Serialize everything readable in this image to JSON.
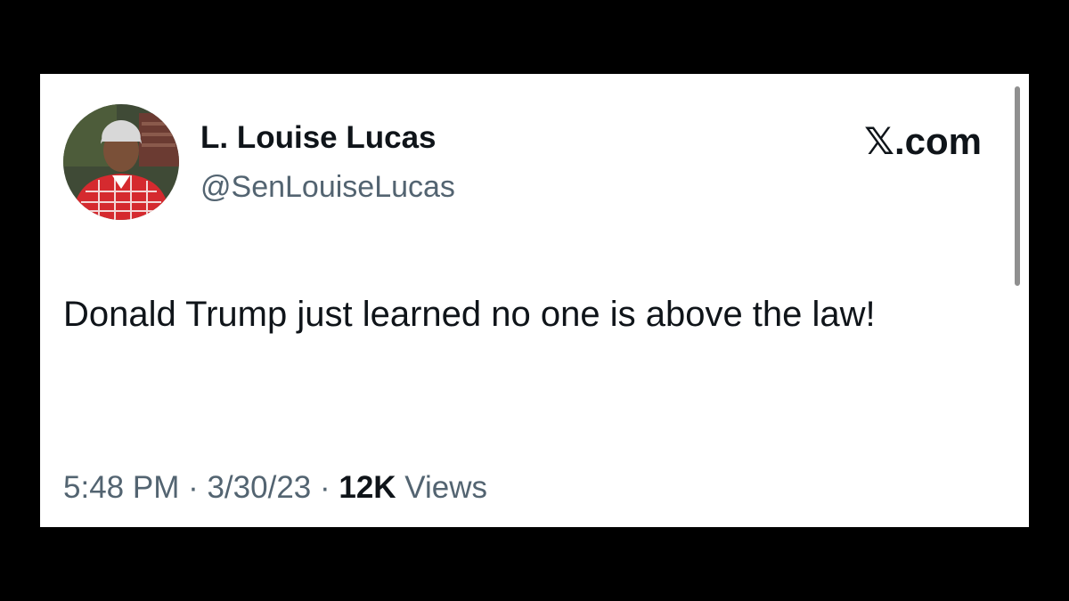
{
  "tweet": {
    "author": {
      "display_name": "L. Louise Lucas",
      "handle": "@SenLouiseLucas",
      "avatar_icon": "profile-photo"
    },
    "brand": {
      "x_glyph": "𝕏",
      "domain_suffix": ".com"
    },
    "text": "Donald Trump just learned no one is above the law!",
    "meta": {
      "time": "5:48 PM",
      "separator_1": " · ",
      "date": "3/30/23",
      "separator_2": " · ",
      "views_count": "12K",
      "views_label": " Views"
    }
  },
  "colors": {
    "background": "#000000",
    "card": "#ffffff",
    "primary_text": "#0f1419",
    "secondary_text": "#536471",
    "scrollbar": "#8f8f8f"
  }
}
